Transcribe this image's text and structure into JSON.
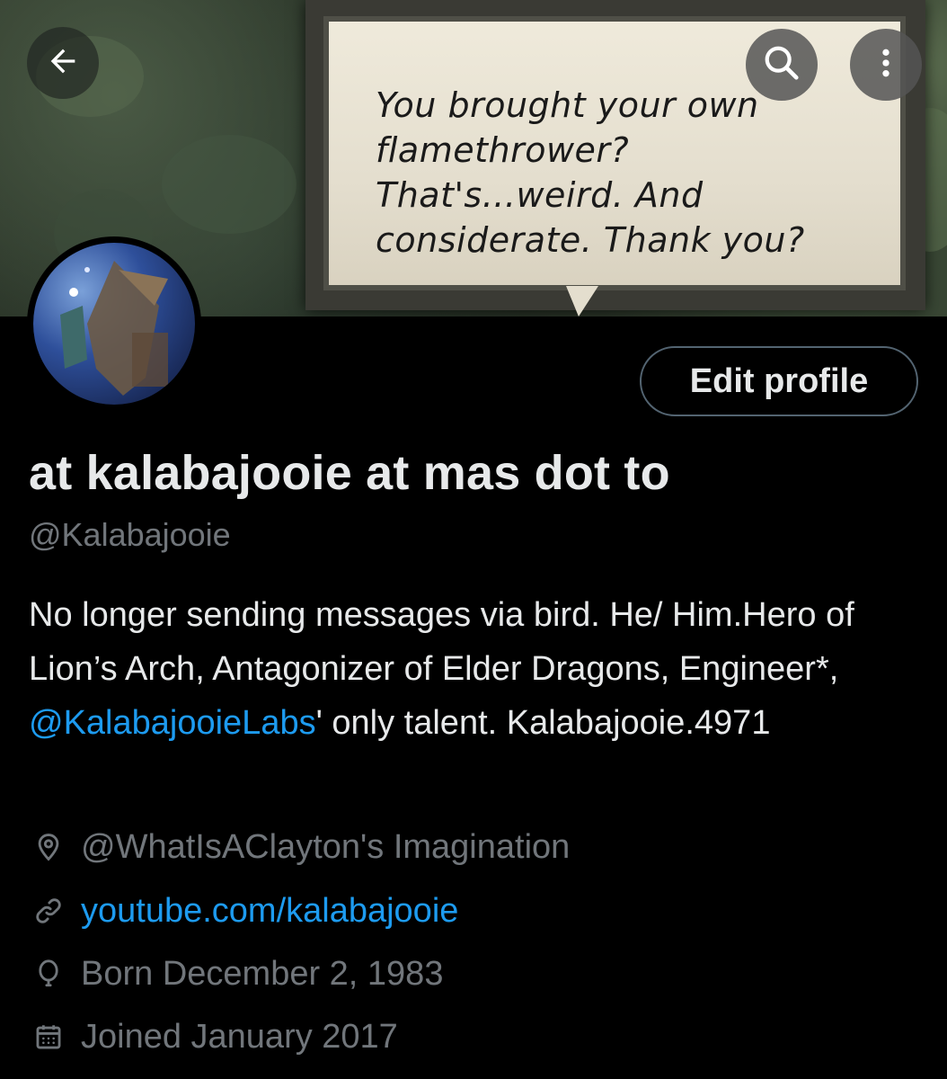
{
  "header": {
    "banner_caption_lines": "You brought your own\nflamethrower?\nThat's...weird. And\nconsiderate. Thank you?"
  },
  "profile": {
    "display_name": "at kalabajooie at mas dot to",
    "handle": "@Kalabajooie",
    "bio_part1": "No longer sending messages via bird.  He/ Him.Hero of Lion’s Arch, Antagonizer of Elder Dragons, Engineer*, ",
    "bio_mention": "@KalabajooieLabs",
    "bio_part2": "' only talent. Kalabajooie.4971",
    "edit_button_label": "Edit profile",
    "location": "@WhatIsAClayton's Imagination",
    "website": "youtube.com/kalabajooie",
    "birthday": "Born December 2, 1983",
    "joined": "Joined January 2017"
  },
  "icons": {
    "back": "arrow-left-icon",
    "search": "search-icon",
    "more": "more-vertical-icon",
    "location": "location-pin-icon",
    "link": "link-icon",
    "birthday": "balloon-icon",
    "calendar": "calendar-icon"
  },
  "colors": {
    "background": "#000000",
    "primary_text": "#e7e9ea",
    "secondary_text": "#71767b",
    "link": "#1d9bf0",
    "button_border": "#536471"
  }
}
